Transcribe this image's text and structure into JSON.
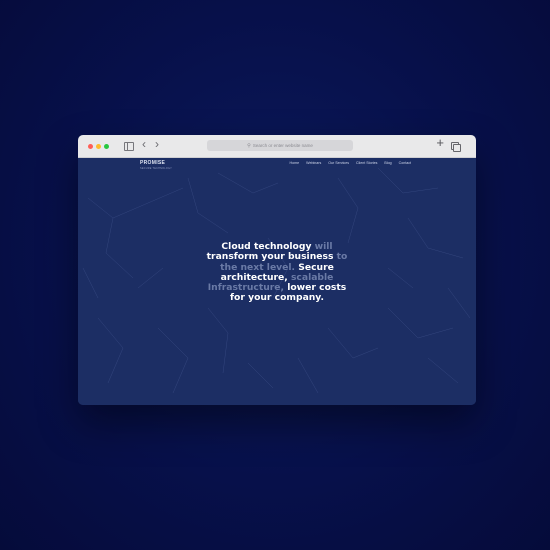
{
  "browser": {
    "address_placeholder": "Search or enter website name"
  },
  "site": {
    "logo": "PROMISE",
    "logo_sub": "SECURE TECHNOLOGY",
    "nav": [
      "Home",
      "Webinars",
      "Our Services",
      "Client Stories",
      "Blog",
      "Contact"
    ]
  },
  "hero": {
    "line1_a": "Cloud technology",
    "line1_b": " will",
    "line2_a": "transform your business",
    "line2_b": " to",
    "line3_a": "the next level.",
    "line3_b": " Secure",
    "line4_a": "architecture,",
    "line4_b": " scalable",
    "line5_a": "Infrastructure,",
    "line5_b": " lower costs",
    "line6": "for your company."
  },
  "colors": {
    "backdrop": "#07104a",
    "page_bg": "#1c2e64",
    "hero_text": "#ffffff",
    "hero_dim": "#6a7aa6"
  }
}
